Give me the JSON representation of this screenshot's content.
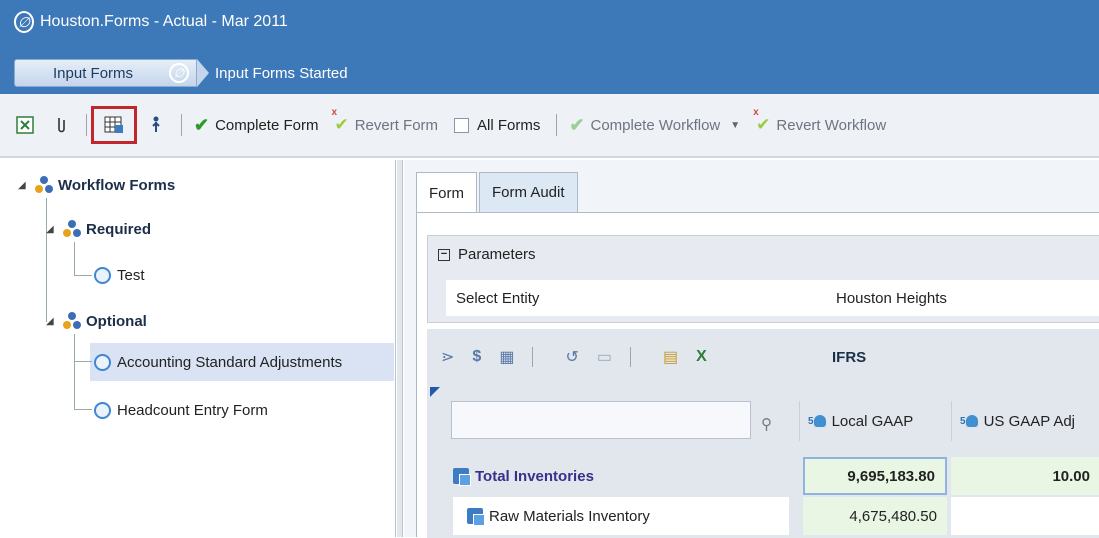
{
  "app": {
    "logo_glyph": "∅",
    "title": "Houston.Forms  -  Actual  -  Mar 2011",
    "breadcrumb": [
      "Input Forms",
      "Input Forms Started"
    ]
  },
  "toolbar": {
    "complete_form": "Complete Form",
    "revert_form": "Revert Form",
    "all_forms": "All Forms",
    "complete_workflow": "Complete Workflow",
    "revert_workflow": "Revert Workflow"
  },
  "tree": {
    "root": "Workflow Forms",
    "required": "Required",
    "required_items": [
      "Test"
    ],
    "optional": "Optional",
    "optional_items": [
      "Accounting Standard Adjustments",
      "Headcount Entry Form"
    ]
  },
  "tabs": [
    "Form",
    "Form Audit"
  ],
  "parameters": {
    "header": "Parameters",
    "label": "Select Entity",
    "value": "Houston Heights"
  },
  "grid": {
    "title": "IFRS",
    "columns": [
      "Local GAAP",
      "US GAAP Adj"
    ],
    "rows": [
      {
        "label": "Total Inventories",
        "values": [
          "9,695,183.80",
          "10.00"
        ]
      },
      {
        "label": "Raw Materials Inventory",
        "values": [
          "4,675,480.50",
          ""
        ]
      }
    ]
  },
  "colors": {
    "accent": "#3d78b8",
    "highlight": "#c0262c",
    "selection": "#d9e3f4"
  }
}
